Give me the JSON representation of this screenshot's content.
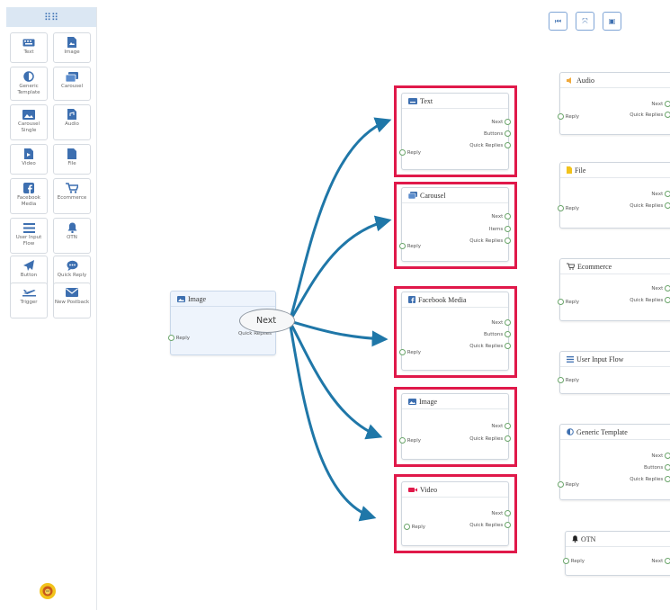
{
  "sidebar": {
    "header_icon": "grid-icon",
    "items": [
      {
        "label": "Text",
        "icon": "keyboard-icon"
      },
      {
        "label": "Image",
        "icon": "image-file-icon"
      },
      {
        "label": "Generic Template",
        "icon": "half-circle-icon"
      },
      {
        "label": "Carousel",
        "icon": "images-icon"
      },
      {
        "label": "Carousel Single",
        "icon": "picture-icon"
      },
      {
        "label": "Audio",
        "icon": "audio-file-icon"
      },
      {
        "label": "Video",
        "icon": "video-file-icon"
      },
      {
        "label": "File",
        "icon": "file-icon"
      },
      {
        "label": "Facebook Media",
        "icon": "facebook-icon"
      },
      {
        "label": "Ecommerce",
        "icon": "cart-icon"
      },
      {
        "label": "User Input Flow",
        "icon": "lines-icon"
      },
      {
        "label": "OTN",
        "icon": "bell-icon"
      },
      {
        "label": "Button",
        "icon": "send-icon"
      },
      {
        "label": "Quick Reply",
        "icon": "chat-icon"
      },
      {
        "label": "Trigger",
        "icon": "plane-icon"
      },
      {
        "label": "New Postback",
        "icon": "envelope-icon"
      }
    ]
  },
  "toolbar": {
    "buttons": [
      {
        "name": "first-icon",
        "glyph": "⏮"
      },
      {
        "name": "fit-icon",
        "glyph": "⤧"
      },
      {
        "name": "save-icon",
        "glyph": "▣"
      }
    ]
  },
  "colors": {
    "accent": "#1f77a8",
    "highlight": "#e0194a",
    "port": "#6aa56a"
  },
  "source_node": {
    "title": "Image",
    "reply": "Reply",
    "next": "Next",
    "quick_replies": "Quick Replies"
  },
  "target_nodes": [
    {
      "title": "Text",
      "ports": [
        "Next",
        "Buttons",
        "Quick Replies"
      ],
      "reply": "Reply"
    },
    {
      "title": "Carousel",
      "ports": [
        "Next",
        "Items",
        "Quick Replies"
      ],
      "reply": "Reply"
    },
    {
      "title": "Facebook Media",
      "ports": [
        "Next",
        "Buttons",
        "Quick Replies"
      ],
      "reply": "Reply"
    },
    {
      "title": "Image",
      "ports": [
        "Next",
        "Quick Replies"
      ],
      "reply": "Reply"
    },
    {
      "title": "Video",
      "ports": [
        "Next",
        "Quick Replies"
      ],
      "reply": "Reply"
    }
  ],
  "right_nodes": [
    {
      "title": "Audio",
      "ports": [
        "Next",
        "Quick Replies"
      ],
      "reply": "Reply"
    },
    {
      "title": "File",
      "ports": [
        "Next",
        "Quick Replies"
      ],
      "reply": "Reply"
    },
    {
      "title": "Ecommerce",
      "ports": [
        "Next",
        "Quick Replies"
      ],
      "reply": "Reply"
    },
    {
      "title": "User Input Flow",
      "ports": [],
      "reply": "Reply"
    },
    {
      "title": "Generic Template",
      "ports": [
        "Next",
        "Buttons",
        "Quick Replies"
      ],
      "reply": "Reply"
    },
    {
      "title": "OTN",
      "ports": [
        "Next"
      ],
      "reply": "Reply"
    }
  ]
}
